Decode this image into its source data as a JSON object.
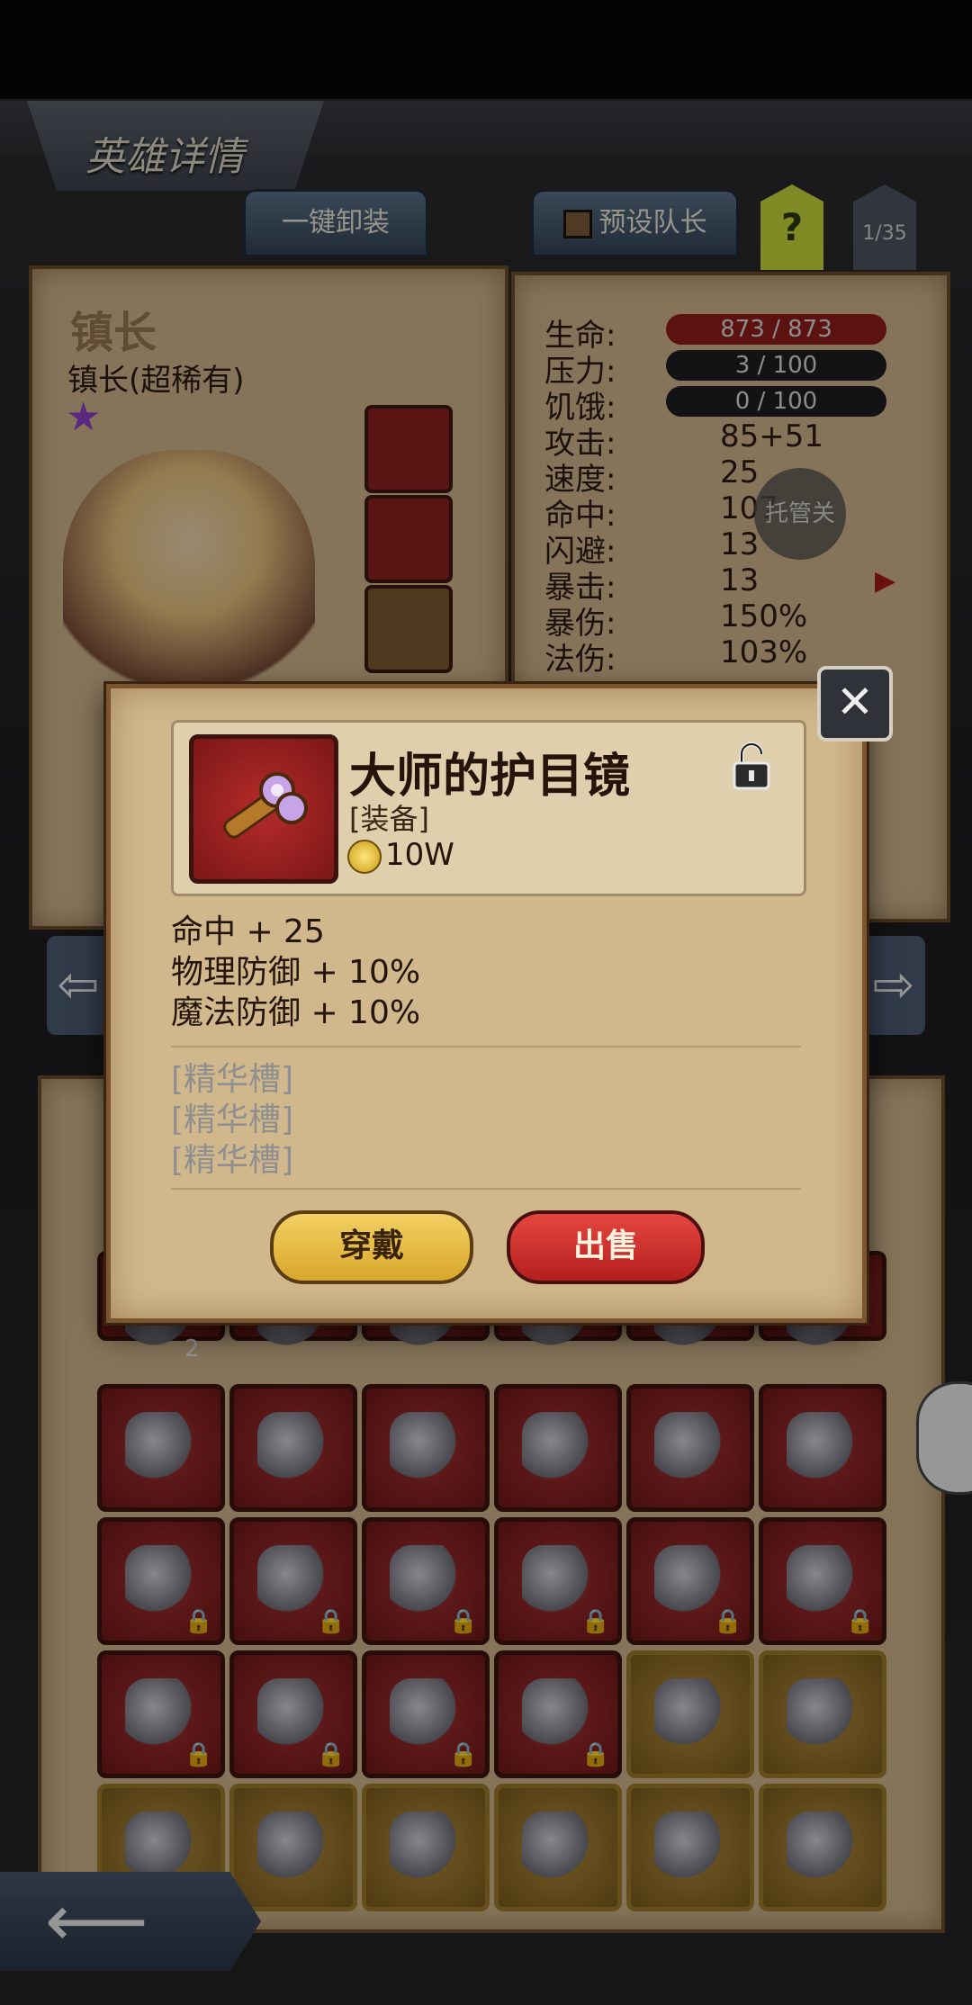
{
  "header": {
    "title": "英雄详情",
    "unequip_all_label": "一键卸装",
    "preset_leader_label": "预设队长",
    "help_label": "?",
    "page_counter": "1/35"
  },
  "hero": {
    "name": "镇长",
    "subtitle": "镇长(超稀有)",
    "star": "★"
  },
  "stats": [
    {
      "label": "生命:",
      "value": "873 / 873",
      "kind": "bar",
      "color": "#8f1d1d"
    },
    {
      "label": "压力:",
      "value": "3 / 100",
      "kind": "bar",
      "color": "#1e1e22"
    },
    {
      "label": "饥饿:",
      "value": "0 / 100",
      "kind": "bar",
      "color": "#1e1e22"
    },
    {
      "label": "攻击:",
      "value": "85+51"
    },
    {
      "label": "速度:",
      "value": "25"
    },
    {
      "label": "命中:",
      "value": "107"
    },
    {
      "label": "闪避:",
      "value": "13"
    },
    {
      "label": "暴击:",
      "value": "13"
    },
    {
      "label": "暴伤:",
      "value": "150%"
    },
    {
      "label": "法伤:",
      "value": "103%"
    }
  ],
  "auto_manage_label": "托管关",
  "modal": {
    "item_name": "大师的护目镜",
    "item_type": "[装备]",
    "price": "10W",
    "attributes": [
      "命中 + 25",
      "物理防御 + 10%",
      "魔法防御 + 10%"
    ],
    "sockets": [
      "[精华槽]",
      "[精华槽]",
      "[精华槽]"
    ],
    "equip_label": "穿戴",
    "sell_label": "出售"
  },
  "inventory": {
    "first_row_count": "2"
  },
  "icons": {
    "close": "close-icon",
    "lock": "padlock-icon",
    "coin": "coin-icon",
    "back": "back-arrow-icon"
  }
}
